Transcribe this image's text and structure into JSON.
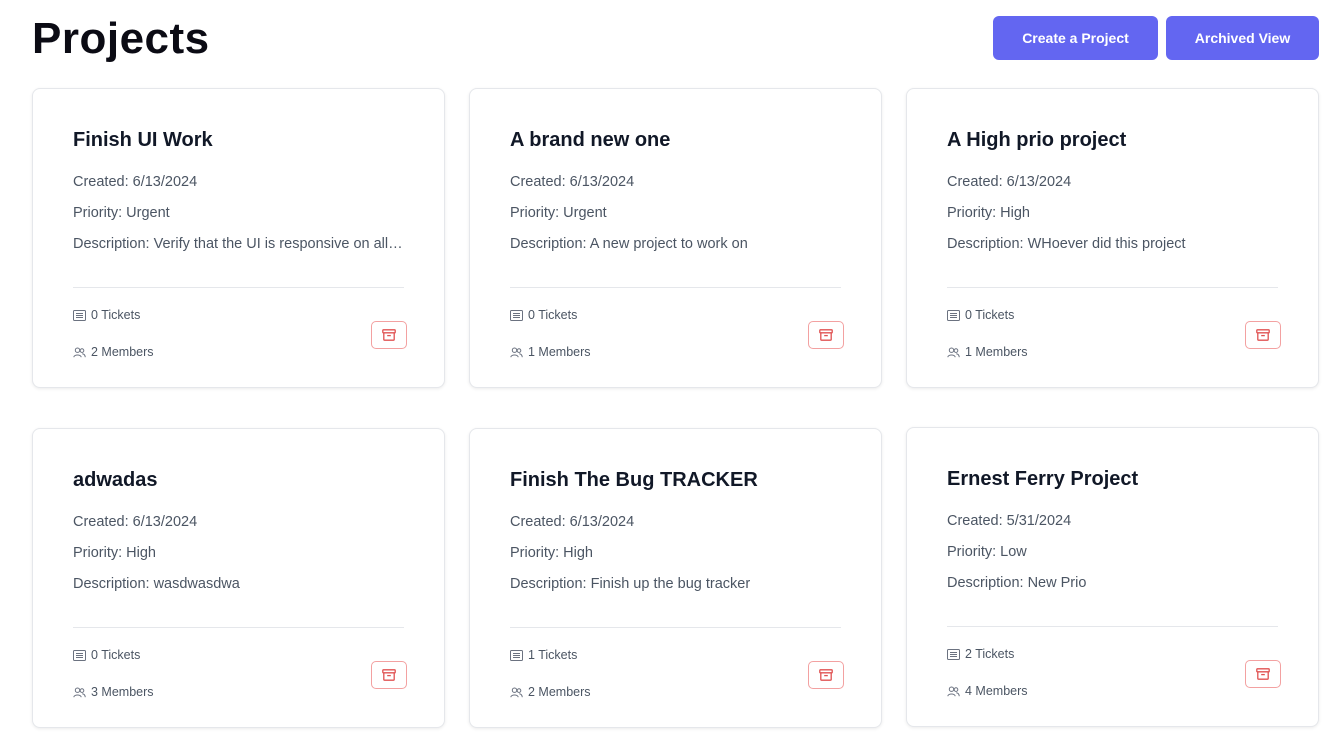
{
  "header": {
    "title": "Projects",
    "create_label": "Create a Project",
    "archived_label": "Archived View"
  },
  "projects": [
    {
      "title": "Finish UI Work",
      "created": "Created: 6/13/2024",
      "priority": "Priority: Urgent",
      "description": "Description: Verify that the UI is responsive on all devices",
      "tickets": "0 Tickets",
      "members": "2 Members"
    },
    {
      "title": "A brand new one",
      "created": "Created: 6/13/2024",
      "priority": "Priority: Urgent",
      "description": "Description: A new project to work on",
      "tickets": "0 Tickets",
      "members": "1 Members"
    },
    {
      "title": "A High prio project",
      "created": "Created: 6/13/2024",
      "priority": "Priority: High",
      "description": "Description: WHoever did this project",
      "tickets": "0 Tickets",
      "members": "1 Members"
    },
    {
      "title": "adwadas",
      "created": "Created: 6/13/2024",
      "priority": "Priority: High",
      "description": "Description: wasdwasdwa",
      "tickets": "0 Tickets",
      "members": "3 Members"
    },
    {
      "title": "Finish The Bug TRACKER",
      "created": "Created: 6/13/2024",
      "priority": "Priority: High",
      "description": "Description: Finish up the bug tracker",
      "tickets": "1 Tickets",
      "members": "2 Members"
    },
    {
      "title": "Ernest Ferry Project",
      "created": "Created: 5/31/2024",
      "priority": "Priority: Low",
      "description": "Description: New Prio",
      "tickets": "2 Tickets",
      "members": "4 Members"
    }
  ],
  "colors": {
    "accent": "#6366f1",
    "archive_icon": "#e05252"
  },
  "icons": {
    "tickets": "ticket-list-icon",
    "members": "members-icon",
    "archive": "archive-box-icon"
  }
}
